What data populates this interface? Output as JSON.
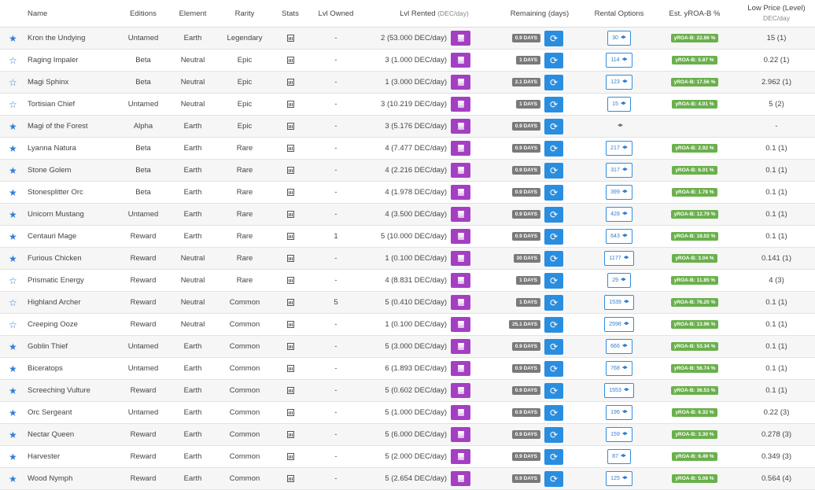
{
  "header": {
    "name": "Name",
    "editions": "Editions",
    "element": "Element",
    "rarity": "Rarity",
    "stats": "Stats",
    "lvl_owned": "Lvl Owned",
    "lvl_rented": "Lvl Rented",
    "lvl_rented_sub": "(DEC/day)",
    "remaining": "Remaining (days)",
    "rental_options": "Rental Options",
    "yroa": "Est. yROA-B %",
    "low_price": "Low Price (Level)",
    "low_price_sub": "DEC/day"
  },
  "rows": [
    {
      "fav": true,
      "name": "Kron the Undying",
      "edition": "Untamed",
      "element": "Earth",
      "rarity": "Legendary",
      "owned": "-",
      "rented": "2 (53.000 DEC/day)",
      "days": "0.9 DAYS",
      "option": "30",
      "yroa": "yROA-B: 22.86 %",
      "low": "15 (1)"
    },
    {
      "fav": false,
      "name": "Raging Impaler",
      "edition": "Beta",
      "element": "Neutral",
      "rarity": "Epic",
      "owned": "-",
      "rented": "3 (1.000 DEC/day)",
      "days": "1 DAYS",
      "option": "114",
      "yroa": "yROA-B: 5.87 %",
      "low": "0.22 (1)"
    },
    {
      "fav": false,
      "name": "Magi Sphinx",
      "edition": "Beta",
      "element": "Neutral",
      "rarity": "Epic",
      "owned": "-",
      "rented": "1 (3.000 DEC/day)",
      "days": "2.1 DAYS",
      "option": "123",
      "yroa": "yROA-B: 17.56 %",
      "low": "2.962 (1)"
    },
    {
      "fav": false,
      "name": "Tortisian Chief",
      "edition": "Untamed",
      "element": "Neutral",
      "rarity": "Epic",
      "owned": "-",
      "rented": "3 (10.219 DEC/day)",
      "days": "1 DAYS",
      "option": "15",
      "yroa": "yROA-B: 4.01 %",
      "low": "5 (2)"
    },
    {
      "fav": true,
      "name": "Magi of the Forest",
      "edition": "Alpha",
      "element": "Earth",
      "rarity": "Epic",
      "owned": "-",
      "rented": "3 (5.176 DEC/day)",
      "days": "0.9 DAYS",
      "option": "",
      "yroa": "",
      "low": "-"
    },
    {
      "fav": true,
      "name": "Lyanna Natura",
      "edition": "Beta",
      "element": "Earth",
      "rarity": "Rare",
      "owned": "-",
      "rented": "4 (7.477 DEC/day)",
      "days": "0.9 DAYS",
      "option": "217",
      "yroa": "yROA-B: 2.92 %",
      "low": "0.1 (1)"
    },
    {
      "fav": true,
      "name": "Stone Golem",
      "edition": "Beta",
      "element": "Earth",
      "rarity": "Rare",
      "owned": "-",
      "rented": "4 (2.216 DEC/day)",
      "days": "0.9 DAYS",
      "option": "317",
      "yroa": "yROA-B: 6.01 %",
      "low": "0.1 (1)"
    },
    {
      "fav": true,
      "name": "Stonesplitter Orc",
      "edition": "Beta",
      "element": "Earth",
      "rarity": "Rare",
      "owned": "-",
      "rented": "4 (1.978 DEC/day)",
      "days": "0.9 DAYS",
      "option": "399",
      "yroa": "yROA-B: 1.78 %",
      "low": "0.1 (1)"
    },
    {
      "fav": true,
      "name": "Unicorn Mustang",
      "edition": "Untamed",
      "element": "Earth",
      "rarity": "Rare",
      "owned": "-",
      "rented": "4 (3.500 DEC/day)",
      "days": "0.9 DAYS",
      "option": "428",
      "yroa": "yROA-B: 12.79 %",
      "low": "0.1 (1)"
    },
    {
      "fav": true,
      "name": "Centauri Mage",
      "edition": "Reward",
      "element": "Earth",
      "rarity": "Rare",
      "owned": "1",
      "rented": "5 (10.000 DEC/day)",
      "days": "0.9 DAYS",
      "option": "643",
      "yroa": "yROA-B: 18.02 %",
      "low": "0.1 (1)"
    },
    {
      "fav": true,
      "name": "Furious Chicken",
      "edition": "Reward",
      "element": "Neutral",
      "rarity": "Rare",
      "owned": "-",
      "rented": "1 (0.100 DEC/day)",
      "days": "30 DAYS",
      "option": "1177",
      "yroa": "yROA-B: 3.04 %",
      "low": "0.141 (1)"
    },
    {
      "fav": false,
      "name": "Prismatic Energy",
      "edition": "Reward",
      "element": "Neutral",
      "rarity": "Rare",
      "owned": "-",
      "rented": "4 (8.831 DEC/day)",
      "days": "1 DAYS",
      "option": "29",
      "yroa": "yROA-B: 11.85 %",
      "low": "4 (3)"
    },
    {
      "fav": false,
      "name": "Highland Archer",
      "edition": "Reward",
      "element": "Neutral",
      "rarity": "Common",
      "owned": "5",
      "rented": "5 (0.410 DEC/day)",
      "days": "1 DAYS",
      "option": "1539",
      "yroa": "yROA-B: 76.20 %",
      "low": "0.1 (1)"
    },
    {
      "fav": false,
      "name": "Creeping Ooze",
      "edition": "Reward",
      "element": "Neutral",
      "rarity": "Common",
      "owned": "-",
      "rented": "1 (0.100 DEC/day)",
      "days": "25.1 DAYS",
      "option": "2598",
      "yroa": "yROA-B: 13.96 %",
      "low": "0.1 (1)"
    },
    {
      "fav": true,
      "name": "Goblin Thief",
      "edition": "Untamed",
      "element": "Earth",
      "rarity": "Common",
      "owned": "-",
      "rented": "5 (3.000 DEC/day)",
      "days": "0.9 DAYS",
      "option": "666",
      "yroa": "yROA-B: 53.34 %",
      "low": "0.1 (1)"
    },
    {
      "fav": true,
      "name": "Biceratops",
      "edition": "Untamed",
      "element": "Earth",
      "rarity": "Common",
      "owned": "-",
      "rented": "6 (1.893 DEC/day)",
      "days": "0.9 DAYS",
      "option": "768",
      "yroa": "yROA-B: 56.74 %",
      "low": "0.1 (1)"
    },
    {
      "fav": true,
      "name": "Screeching Vulture",
      "edition": "Reward",
      "element": "Earth",
      "rarity": "Common",
      "owned": "-",
      "rented": "5 (0.602 DEC/day)",
      "days": "0.9 DAYS",
      "option": "1553",
      "yroa": "yROA-B: 36.53 %",
      "low": "0.1 (1)"
    },
    {
      "fav": true,
      "name": "Orc Sergeant",
      "edition": "Untamed",
      "element": "Earth",
      "rarity": "Common",
      "owned": "-",
      "rented": "5 (1.000 DEC/day)",
      "days": "0.9 DAYS",
      "option": "196",
      "yroa": "yROA-B: 6.32 %",
      "low": "0.22 (3)"
    },
    {
      "fav": true,
      "name": "Nectar Queen",
      "edition": "Reward",
      "element": "Earth",
      "rarity": "Common",
      "owned": "-",
      "rented": "5 (6.000 DEC/day)",
      "days": "0.9 DAYS",
      "option": "159",
      "yroa": "yROA-B: 3.30 %",
      "low": "0.278 (3)"
    },
    {
      "fav": true,
      "name": "Harvester",
      "edition": "Reward",
      "element": "Earth",
      "rarity": "Common",
      "owned": "-",
      "rented": "5 (2.000 DEC/day)",
      "days": "0.9 DAYS",
      "option": "87",
      "yroa": "yROA-B: 6.49 %",
      "low": "0.349 (3)"
    },
    {
      "fav": true,
      "name": "Wood Nymph",
      "edition": "Reward",
      "element": "Earth",
      "rarity": "Common",
      "owned": "-",
      "rented": "5 (2.654 DEC/day)",
      "days": "0.9 DAYS",
      "option": "125",
      "yroa": "yROA-B: 5.08 %",
      "low": "0.564 (4)"
    }
  ]
}
